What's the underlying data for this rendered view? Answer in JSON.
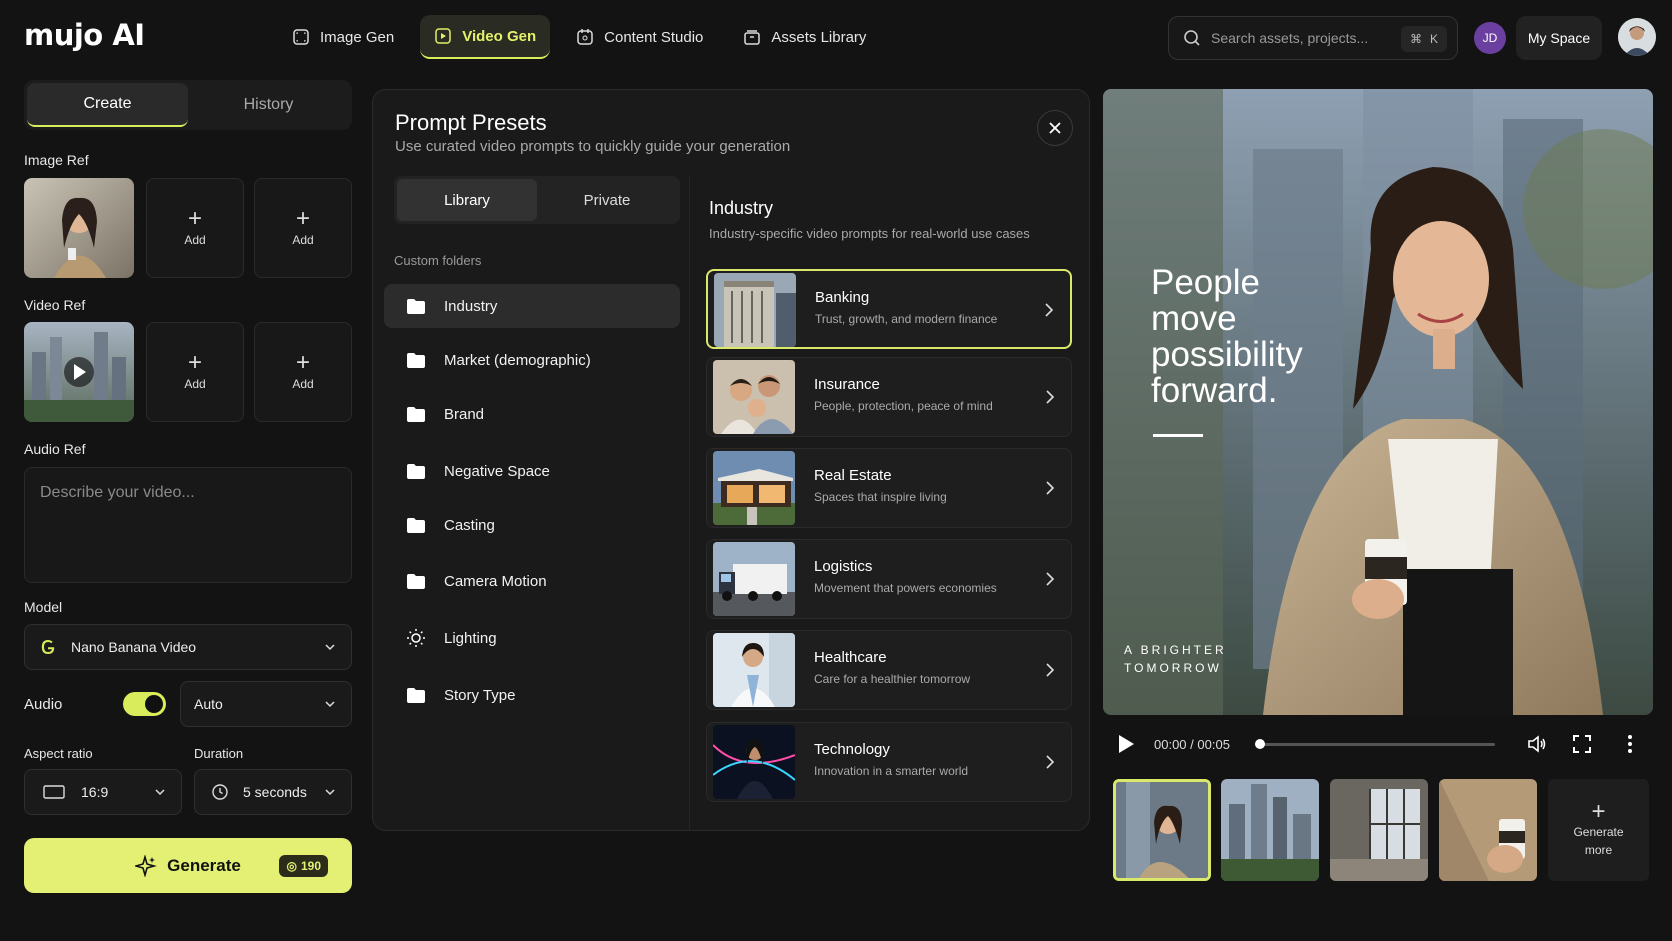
{
  "app": {
    "logo": "mujo AI"
  },
  "nav": {
    "items": [
      {
        "label": "Image Gen",
        "icon": "image-icon"
      },
      {
        "label": "Video Gen",
        "icon": "video-icon",
        "active": true
      },
      {
        "label": "Content Studio",
        "icon": "studio-icon"
      },
      {
        "label": "Assets Library",
        "icon": "library-icon"
      }
    ]
  },
  "search": {
    "placeholder": "Search assets, projects...",
    "shortcut_symbol": "⌘",
    "shortcut_key": "K"
  },
  "user": {
    "initials": "JD",
    "space_label": "My Space"
  },
  "left": {
    "tabs": [
      "Create",
      "History"
    ],
    "image_ref_label": "Image Ref",
    "video_ref_label": "Video Ref",
    "audio_ref_label": "Audio Ref",
    "add_label": "Add",
    "prompt_placeholder": "Describe your video...",
    "model_label": "Model",
    "model_value": "Nano Banana Video",
    "audio_label": "Audio",
    "audio_enabled": true,
    "audio_mode": "Auto",
    "aspect_label": "Aspect ratio",
    "aspect_value": "16:9",
    "duration_label": "Duration",
    "duration_value": "5 seconds",
    "generate_label": "Generate",
    "credits": "190"
  },
  "modal": {
    "title": "Prompt Presets",
    "subtitle": "Use curated video prompts to quickly guide your generation",
    "tabs": [
      "Library",
      "Private"
    ],
    "folders_label": "Custom folders",
    "folders": [
      {
        "label": "Industry",
        "icon": "folder-icon"
      },
      {
        "label": "Market (demographic)",
        "icon": "folder-icon"
      },
      {
        "label": "Brand",
        "icon": "folder-icon"
      },
      {
        "label": "Negative Space",
        "icon": "folder-icon"
      },
      {
        "label": "Casting",
        "icon": "folder-icon"
      },
      {
        "label": "Camera Motion",
        "icon": "folder-icon"
      },
      {
        "label": "Lighting",
        "icon": "sun-icon"
      },
      {
        "label": "Story Type",
        "icon": "folder-icon"
      }
    ],
    "category": {
      "title": "Industry",
      "subtitle": "Industry-specific video prompts for real-world use cases",
      "cards": [
        {
          "title": "Banking",
          "desc": "Trust, growth, and modern finance"
        },
        {
          "title": "Insurance",
          "desc": "People, protection, peace of mind"
        },
        {
          "title": "Real Estate",
          "desc": "Spaces that inspire living"
        },
        {
          "title": "Logistics",
          "desc": "Movement that powers economies"
        },
        {
          "title": "Healthcare",
          "desc": "Care for a healthier tomorrow"
        },
        {
          "title": "Technology",
          "desc": "Innovation in a smarter world"
        }
      ]
    }
  },
  "preview": {
    "headline": [
      "People",
      "move",
      "possibility",
      "forward."
    ],
    "tagline": [
      "A BRIGHTER",
      "TOMORROW"
    ],
    "time_current": "00:00",
    "time_total": "00:05",
    "generate_more": [
      "Generate",
      "more"
    ]
  }
}
